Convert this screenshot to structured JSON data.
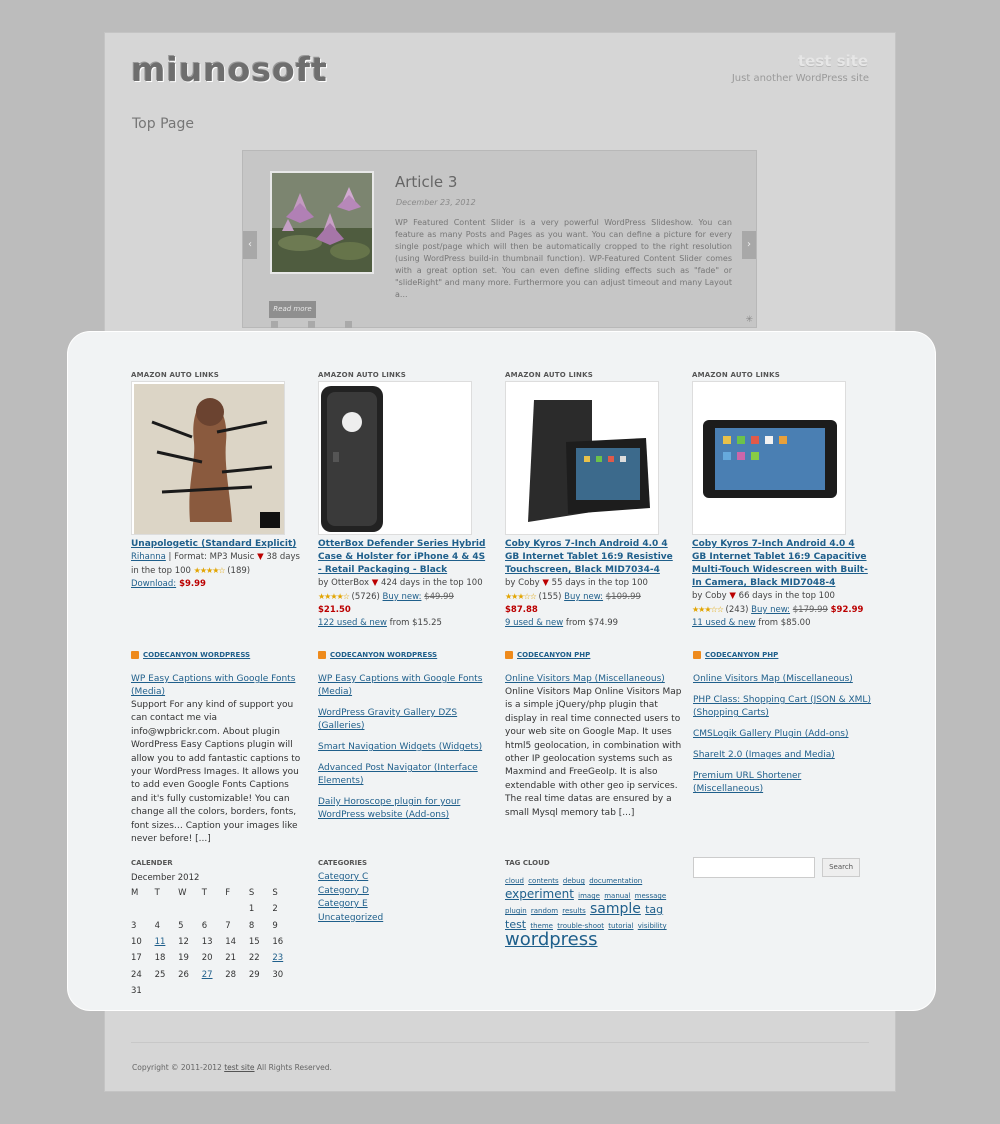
{
  "header": {
    "logo": "miunosoft",
    "site_title": "test site",
    "site_description": "Just another WordPress site"
  },
  "page": {
    "title": "Top Page"
  },
  "slider": {
    "title": "Article 3",
    "date": "December 23, 2012",
    "text": "WP Featured Content Slider is a very powerful WordPress Slideshow. You can feature as many Posts and Pages as you want. You can define a picture for every single post/page which will then be automatically cropped to the right resolution (using WordPress build-in thumbnail function). WP-Featured Content Slider comes with a great option set. You can even define sliding effects such as \"fade\" or \"slideRight\" and many more. Furthermore you can adjust timeout and many Layout a...",
    "read_more": "Read more",
    "prev": "‹",
    "next": "›",
    "pause": "✳"
  },
  "amazon": [
    {
      "widget": "AMAZON AUTO LINKS",
      "title": "Unapologetic (Standard Explicit)",
      "line1_link": "Rihanna",
      "line1_text": " | Format: MP3 Music ",
      "arrow": "▼",
      "rank": " 38 days in the top 100 ",
      "stars": "★★★★☆",
      "reviews": " (189)",
      "line3_link": "Download:",
      "line3_price": " $9.99",
      "line3_text": ""
    },
    {
      "widget": "AMAZON AUTO LINKS",
      "title": "OtterBox Defender Series Hybrid Case & Holster for iPhone 4 & 4S - Retail Packaging - Black",
      "by": "by OtterBox ",
      "arrow": "▼",
      "rank": " 424 days in the top 100",
      "stars": "★★★★☆",
      "reviews": " (5726) ",
      "buy": "Buy new:",
      "old": "$49.99",
      "price": "$21.50",
      "used": "122 used & new",
      "from": " from $15.25"
    },
    {
      "widget": "AMAZON AUTO LINKS",
      "title": "Coby Kyros 7-Inch Android 4.0 4 GB Internet Tablet 16:9 Resistive Touchscreen, Black MID7034-4",
      "by": "by Coby ",
      "arrow": "▼",
      "rank": " 55 days in the top 100",
      "stars": "★★★☆☆",
      "reviews": " (155) ",
      "buy": "Buy new:",
      "old": "$109.99",
      "price": "$87.88",
      "used": "9 used & new",
      "from": " from $74.99"
    },
    {
      "widget": "AMAZON AUTO LINKS",
      "title": "Coby Kyros 7-Inch Android 4.0 4 GB Internet Tablet 16:9 Capacitive Multi-Touch Widescreen with Built-In Camera, Black MID7048-4",
      "by": "by Coby ",
      "arrow": "▼",
      "rank": " 66 days in the top 100",
      "stars": "★★★☆☆",
      "reviews": " (243) ",
      "buy": "Buy new:",
      "old": "$179.99",
      "price": "$92.99",
      "used": "11 used & new",
      "from": " from $85.00"
    }
  ],
  "rss": [
    {
      "head": "CODECANYON WORDPRESS",
      "links": [
        "WP Easy Captions with Google Fonts (Media)"
      ],
      "desc": "Support For any kind of support you can contact me via info@wpbrickr.com. About plugin WordPress Easy Captions plugin will allow you to add fantastic captions to your WordPress Images. It allows you to add even Google Fonts Captions and it's fully customizable! You can change all the colors, borders, fonts, font sizes… Caption your images like never before! [...]"
    },
    {
      "head": "CODECANYON WORDPRESS",
      "links": [
        "WP Easy Captions with Google Fonts (Media)",
        "WordPress Gravity Gallery DZS (Galleries)",
        "Smart Navigation Widgets (Widgets)",
        "Advanced Post Navigator (Interface Elements)",
        "Daily Horoscope plugin for your WordPress website (Add-ons)"
      ],
      "desc": ""
    },
    {
      "head": "CODECANYON PHP",
      "links": [
        "Online Visitors Map (Miscellaneous)"
      ],
      "desc": "Online Visitors Map Online Visitors Map is a simple jQuery/php plugin that display in real time connected users to your web site on Google Map. It uses html5 geolocation, in combination with other IP geolocation systems such as Maxmind and FreeGeoIp. It is also extendable with other geo ip services. The real time datas are ensured by a small Mysql memory tab [...]"
    },
    {
      "head": "CODECANYON PHP",
      "links": [
        "Online Visitors Map (Miscellaneous)",
        "PHP Class: Shopping Cart (JSON & XML) (Shopping Carts)",
        "CMSLogik Gallery Plugin (Add-ons)",
        "ShareIt 2.0 (Images and Media)",
        "Premium URL Shortener (Miscellaneous)"
      ],
      "desc": ""
    }
  ],
  "calendar": {
    "label": "CALENDER",
    "month": "December 2012",
    "days": [
      "M",
      "T",
      "W",
      "T",
      "F",
      "S",
      "S"
    ],
    "weeks": [
      [
        "",
        "",
        "",
        "",
        "",
        "1",
        "2"
      ],
      [
        "3",
        "4",
        "5",
        "6",
        "7",
        "8",
        "9"
      ],
      [
        "10",
        "11",
        "12",
        "13",
        "14",
        "15",
        "16"
      ],
      [
        "17",
        "18",
        "19",
        "20",
        "21",
        "22",
        "23"
      ],
      [
        "24",
        "25",
        "26",
        "27",
        "28",
        "29",
        "30"
      ],
      [
        "31",
        "",
        "",
        "",
        "",
        "",
        ""
      ]
    ],
    "linked": [
      "11",
      "23",
      "27"
    ]
  },
  "categories": {
    "label": "CATEGORIES",
    "items": [
      "Category C",
      "Category D",
      "Category E",
      "Uncategorized"
    ]
  },
  "tagcloud": {
    "label": "TAG CLOUD",
    "tags": [
      {
        "t": "cloud",
        "s": 7
      },
      {
        "t": "contents",
        "s": 7
      },
      {
        "t": "debug",
        "s": 7
      },
      {
        "t": "documentation",
        "s": 7
      },
      {
        "t": "experiment",
        "s": 12
      },
      {
        "t": "image",
        "s": 7
      },
      {
        "t": "manual",
        "s": 7
      },
      {
        "t": "message",
        "s": 7
      },
      {
        "t": "plugin",
        "s": 7
      },
      {
        "t": "random",
        "s": 7
      },
      {
        "t": "results",
        "s": 7
      },
      {
        "t": "sample",
        "s": 14
      },
      {
        "t": "tag",
        "s": 11
      },
      {
        "t": "test",
        "s": 11
      },
      {
        "t": "theme",
        "s": 7
      },
      {
        "t": "trouble-shoot",
        "s": 7
      },
      {
        "t": "tutorial",
        "s": 7
      },
      {
        "t": "visibility",
        "s": 7
      },
      {
        "t": "wordpress",
        "s": 18
      }
    ]
  },
  "search": {
    "button": "Search",
    "value": ""
  },
  "footer": {
    "prefix": "Copyright © 2011-2012 ",
    "link": "test site",
    "suffix": " All Rights Reserved."
  },
  "colors": {
    "link": "#1f5f8b",
    "price": "#bb0000",
    "rss": "#ee8a1c"
  }
}
